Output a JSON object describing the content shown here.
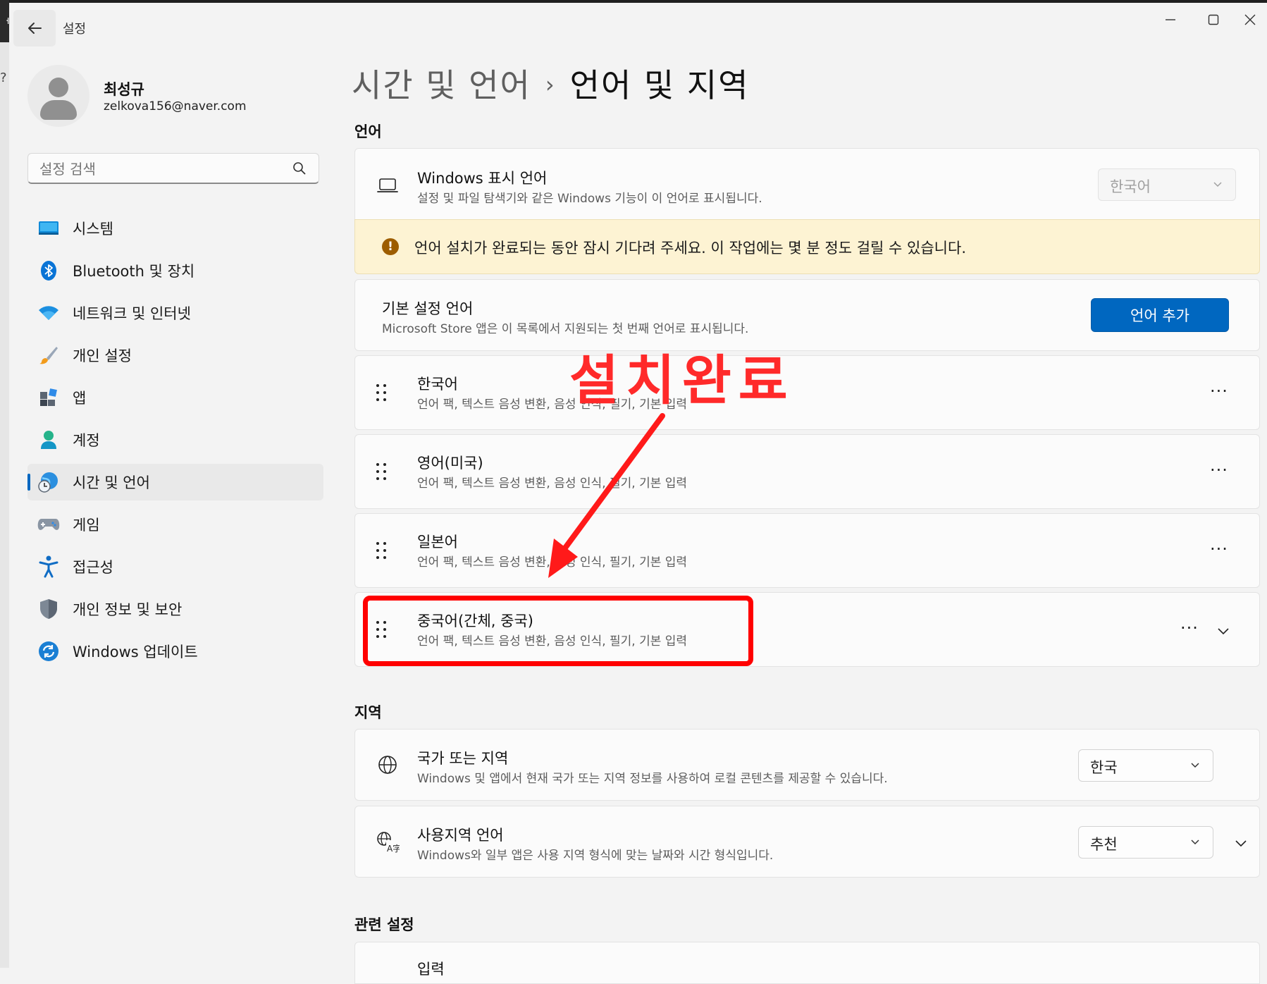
{
  "window": {
    "app_title": "설정",
    "controls": {
      "minimize": "—",
      "maximize": "☐",
      "close": "✕"
    }
  },
  "profile": {
    "name": "최성규",
    "email": "zelkova156@naver.com"
  },
  "search": {
    "placeholder": "설정 검색"
  },
  "nav": {
    "items": [
      {
        "label": "시스템",
        "icon": "monitor-icon"
      },
      {
        "label": "Bluetooth 및 장치",
        "icon": "bluetooth-icon"
      },
      {
        "label": "네트워크 및 인터넷",
        "icon": "wifi-icon"
      },
      {
        "label": "개인 설정",
        "icon": "brush-icon"
      },
      {
        "label": "앱",
        "icon": "apps-icon"
      },
      {
        "label": "계정",
        "icon": "person-icon"
      },
      {
        "label": "시간 및 언어",
        "icon": "globe-clock-icon",
        "active": true
      },
      {
        "label": "게임",
        "icon": "gamepad-icon"
      },
      {
        "label": "접근성",
        "icon": "accessibility-icon"
      },
      {
        "label": "개인 정보 및 보안",
        "icon": "shield-icon"
      },
      {
        "label": "Windows 업데이트",
        "icon": "update-icon"
      }
    ]
  },
  "breadcrumb": {
    "parent": "시간 및 언어",
    "separator": "›",
    "current": "언어 및 지역"
  },
  "language_section": {
    "heading": "언어",
    "display_language": {
      "title": "Windows 표시 언어",
      "description": "설정 및 파일 탐색기와 같은 Windows 기능이 이 언어로 표시됩니다.",
      "value": "한국어"
    },
    "warning": "언어 설치가 완료되는 동안 잠시 기다려 주세요. 이 작업에는 몇 분 정도 걸릴 수 있습니다.",
    "preferred": {
      "title": "기본 설정 언어",
      "description": "Microsoft Store 앱은 이 목록에서 지원되는 첫 번째 언어로 표시됩니다.",
      "add_button": "언어 추가"
    },
    "languages": [
      {
        "name": "한국어",
        "features": "언어 팩, 텍스트 음성 변환, 음성 인식, 필기, 기본 입력"
      },
      {
        "name": "영어(미국)",
        "features": "언어 팩, 텍스트 음성 변환, 음성 인식, 필기, 기본 입력"
      },
      {
        "name": "일본어",
        "features": "언어 팩, 텍스트 음성 변환, 음성 인식, 필기, 기본 입력"
      },
      {
        "name": "중국어(간체, 중국)",
        "features": "언어 팩, 텍스트 음성 변환, 음성 인식, 필기, 기본 입력"
      }
    ],
    "more_label": "···"
  },
  "region_section": {
    "heading": "지역",
    "country": {
      "title": "국가 또는 지역",
      "description": "Windows 및 앱에서 현재 국가 또는 지역 정보를 사용하여 로컬 콘텐츠를 제공할 수 있습니다.",
      "value": "한국"
    },
    "regional_format": {
      "title": "사용지역 언어",
      "description": "Windows와 일부 앱은 사용 지역 형식에 맞는 날짜와 시간 형식입니다.",
      "value": "추천"
    }
  },
  "related_section": {
    "heading": "관련 설정",
    "first_item": "입력"
  },
  "annotation": {
    "text": "설치완료",
    "color": "#ff2a2a"
  },
  "colors": {
    "accent": "#0067c0",
    "warning_bg": "#fdf3d3",
    "warning_icon": "#9d5d00",
    "highlight": "#ff0000"
  }
}
